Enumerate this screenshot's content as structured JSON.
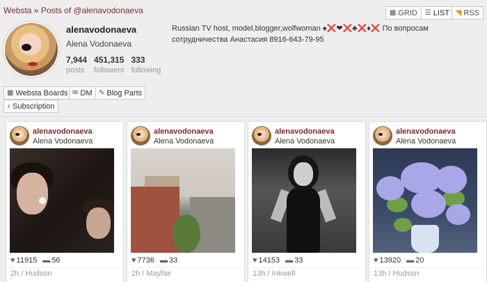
{
  "breadcrumb": {
    "home": "Websta",
    "separator": " » ",
    "current": "Posts of @alenavodonaeva"
  },
  "view_toggle": {
    "grid_label": "GRID",
    "list_label": "LIST",
    "active": "list"
  },
  "rss_label": "RSS",
  "profile": {
    "username": "alenavodonaeva",
    "full_name": "Alena Vodonaeva",
    "stats": [
      {
        "value": "7,944",
        "label": "posts"
      },
      {
        "value": "451,315",
        "label": "followers"
      },
      {
        "value": "333",
        "label": "following"
      }
    ],
    "bio": "Russian TV host, model,blogger,wolfwoman ♠❌❤❌♣❌♦❌ По вопросам сотрудничества Анастасия 8916-643-79-95"
  },
  "tools": {
    "boards": "Websta Boards",
    "dm": "DM",
    "blog_parts": "Blog Parts",
    "subscription": "Subscription"
  },
  "posts": [
    {
      "username": "alenavodonaeva",
      "full_name": "Alena Vodonaeva",
      "likes": "11915",
      "comments": "56",
      "time": "2h / Hudson"
    },
    {
      "username": "alenavodonaeva",
      "full_name": "Alena Vodonaeva",
      "likes": "7736",
      "comments": "33",
      "time": "2h / Mayfair"
    },
    {
      "username": "alenavodonaeva",
      "full_name": "Alena Vodonaeva",
      "likes": "14153",
      "comments": "33",
      "time": "13h / Inkwell"
    },
    {
      "username": "alenavodonaeva",
      "full_name": "Alena Vodonaeva",
      "likes": "13920",
      "comments": "20",
      "time": "13h / Hudson"
    }
  ]
}
